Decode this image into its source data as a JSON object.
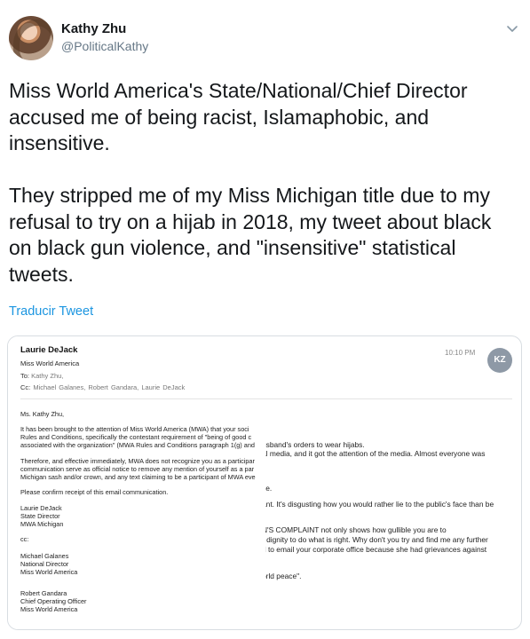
{
  "author": {
    "name": "Kathy Zhu",
    "handle": "@PoliticalKathy"
  },
  "tweet": {
    "paragraphs": [
      "Miss World America's State/National/Chief Director accused me of being racist, Islamaphobic, and insensitive.",
      "They stripped me of my Miss Michigan title due to my refusal to try on a hijab in 2018, my tweet about black on black gun violence, and \"insensitive\" statistical tweets."
    ],
    "translate_label": "Traducir Tweet"
  },
  "email": {
    "from": "Laurie DeJack",
    "org": "Miss World America",
    "to_label": "To:",
    "to_value": "Kathy Zhu,",
    "cc_label": "Cc:",
    "cc_value": "Michael Galanes,    Robert Gandara,    Laurie DeJack",
    "time": "10:10 PM",
    "avatar_initials": "KZ",
    "left_lines": [
      "Ms. Kathy Zhu,",
      "It has been brought to the attention of Miss World America (MWA) that your soci",
      "Rules and Conditions, specifically the contestant requirement of \"being of good c",
      "associated with the organization\" (MWA Rules and Conditions paragraph 1(g) and",
      "Therefore, and effective immediately, MWA does not recognize you as a participar",
      "communication serve as official notice to remove any mention of yourself as a par",
      "Michigan sash and/or crown, and any text claiming to be a participant of MWA eve",
      "Please confirm receipt of this email communication.",
      "Laurie DeJack",
      "State Director",
      "MWA Michigan",
      "cc:",
      "Michael Galanes",
      "National Director",
      "Miss World America",
      "Robert Gandara",
      "Chief Operating Officer",
      "Miss World America"
    ],
    "right_lines": [
      "usband's orders to wear hijabs.",
      "al media, and it got the attention of the media. Almost everyone was",
      "ye.",
      "ant. It's disgusting how you would rather lie to the public's face than be",
      "N'S COMPLAINT not only shows how gullible you are to",
      ") dignity to do what is right. Why don't you try and find me any further",
      "d to email your corporate office because she had grievances against",
      "orld peace\"."
    ]
  }
}
